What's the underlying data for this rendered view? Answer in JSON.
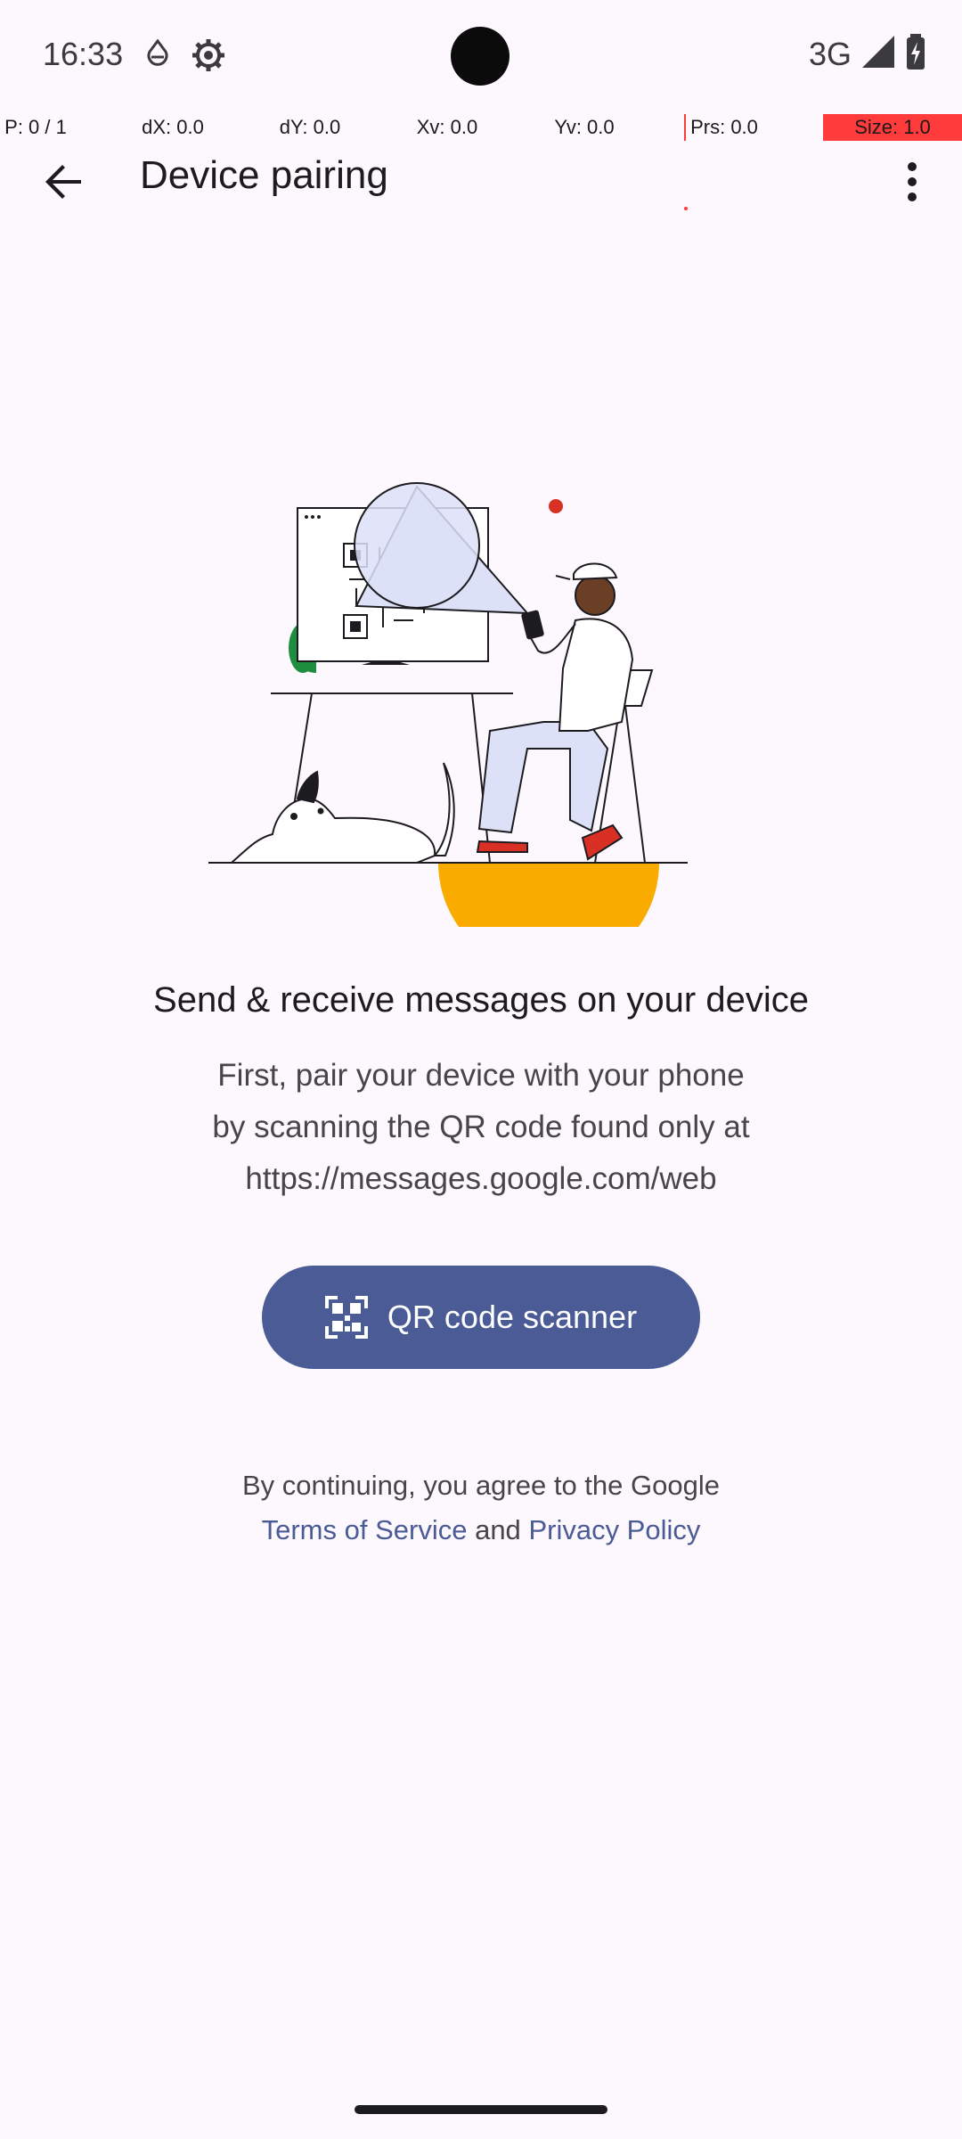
{
  "status_bar": {
    "time": "16:33",
    "network": "3G",
    "icons": [
      "drop-icon",
      "settings-gear-icon",
      "signal-icon",
      "battery-charging-icon"
    ]
  },
  "pointer_overlay": {
    "p": "P: 0 / 1",
    "dx": "dX: 0.0",
    "dy": "dY: 0.0",
    "xv": "Xv: 0.0",
    "yv": "Yv: 0.0",
    "prs": "Prs: 0.0",
    "size": "Size: 1.0",
    "highlight_color": "#ff3b3b"
  },
  "app_bar": {
    "title": "Device pairing",
    "back_icon": "arrow-back-icon",
    "menu_icon": "more-vert-icon"
  },
  "content": {
    "headline": "Send & receive messages on your device",
    "body_line1": "First, pair your device with your phone",
    "body_line2": "by scanning the QR code found only at",
    "body_line3": "https://messages.google.com/web"
  },
  "qr_button": {
    "label": "QR code scanner",
    "icon": "qr-code-scanner-icon",
    "color": "#4a5b96"
  },
  "legal": {
    "prefix": "By continuing, you agree to the Google",
    "terms": "Terms of Service",
    "and": "and",
    "privacy": "Privacy Policy",
    "link_color": "#4a5b96"
  }
}
